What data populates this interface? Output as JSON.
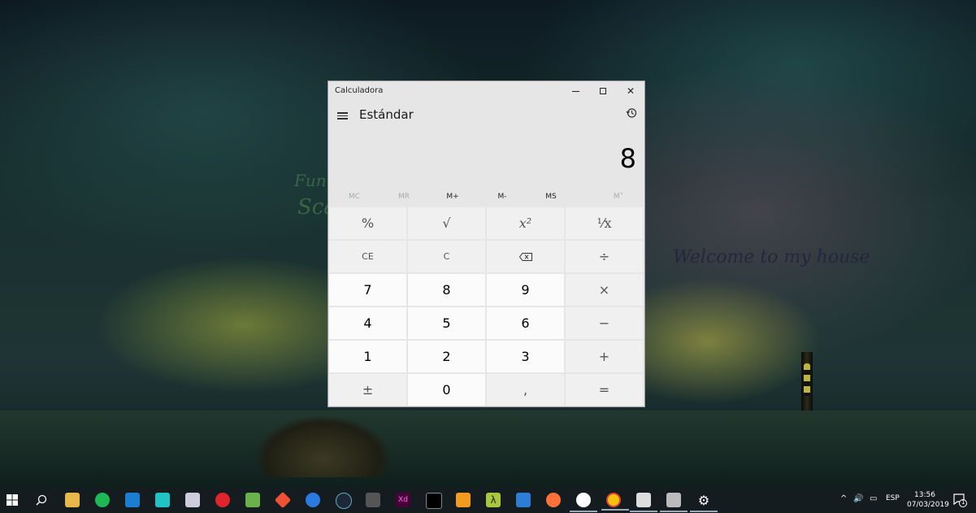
{
  "window": {
    "title": "Calculadora",
    "mode": "Estándar",
    "display": "8",
    "minimize_glyph": "",
    "close_glyph": "✕"
  },
  "memory": [
    "MC",
    "MR",
    "M+",
    "M-",
    "MS",
    "M˅"
  ],
  "keys": [
    "%",
    "√",
    "x²",
    "¹⁄x",
    "CE",
    "C",
    "⌫",
    "÷",
    "7",
    "8",
    "9",
    "×",
    "4",
    "5",
    "6",
    "−",
    "1",
    "2",
    "3",
    "+",
    "±",
    "0",
    ",",
    "="
  ],
  "wallpaper": {
    "text1": "Funny",
    "text2": "Sca",
    "text3": "Welcome to my house"
  },
  "taskbar": {
    "language": "ESP",
    "time": "13:56",
    "date": "07/03/2019",
    "notifications": "1"
  },
  "colors": {
    "calc_bg": "#e6e6e6",
    "number_key": "#fbfbfb",
    "operator_key": "#f0f0f0",
    "taskbar": "#141c20"
  }
}
